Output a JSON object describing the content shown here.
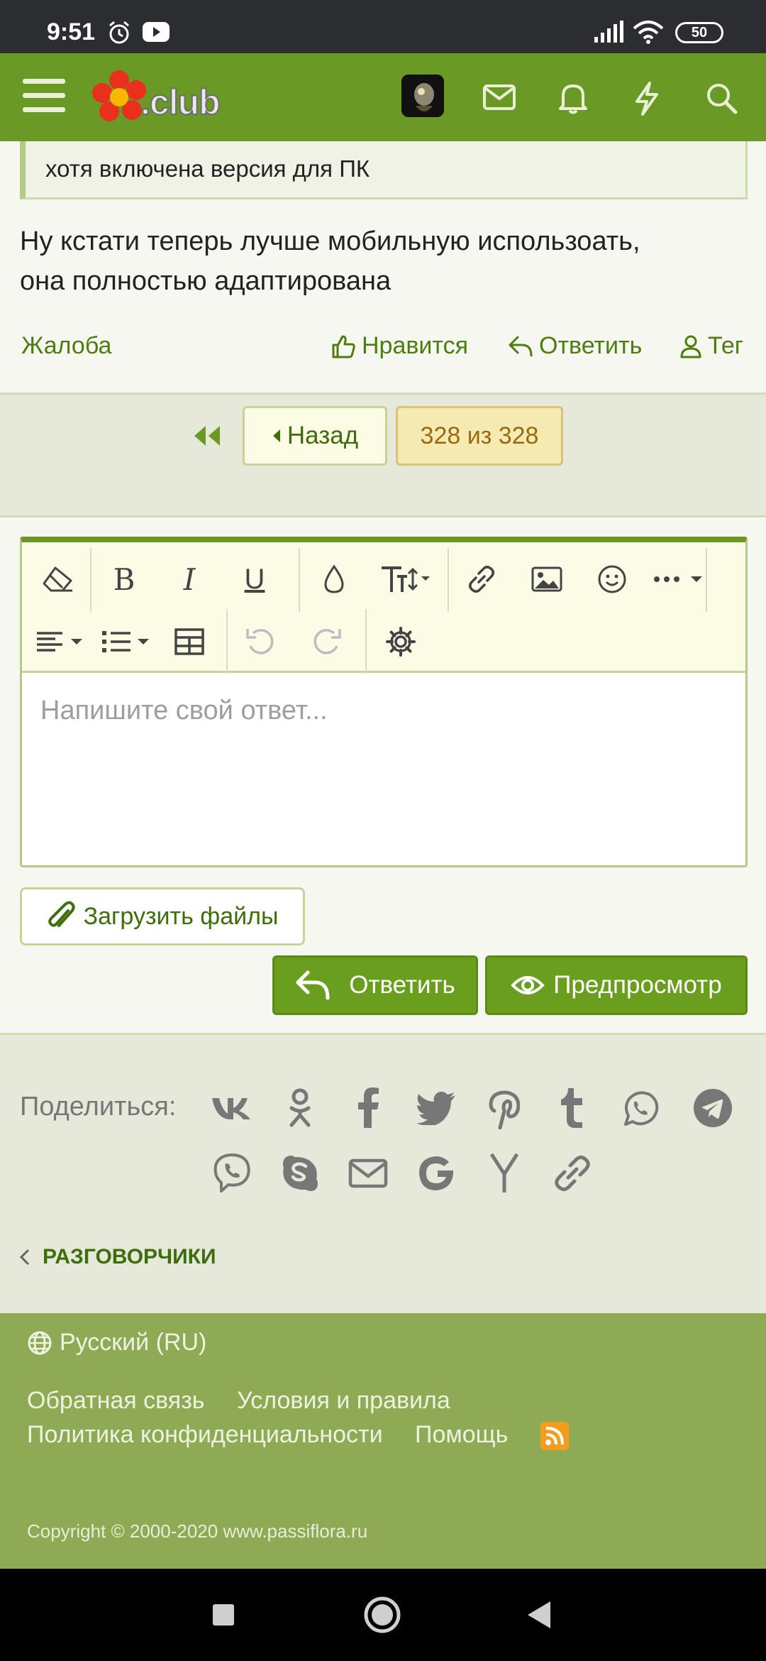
{
  "status_bar": {
    "time": "9:51",
    "battery": "50"
  },
  "header": {
    "logo_text": ".club",
    "icons": [
      "menu-icon",
      "avatar",
      "mail-icon",
      "bell-icon",
      "lightning-icon",
      "search-icon"
    ]
  },
  "post": {
    "quote_text": "хотя включена версия для ПК",
    "body_line1": "Ну кстати теперь лучше мобильную использоать,",
    "body_line2": "она полностью адаптирована",
    "report_label": "Жалоба",
    "like_label": "Нравится",
    "reply_label": "Ответить",
    "tag_label": "Тег"
  },
  "pager": {
    "back_label": "Назад",
    "count_label": "328 из 328"
  },
  "editor": {
    "placeholder": "Напишите свой ответ...",
    "toolbar": [
      "eraser-icon",
      "bold-icon",
      "italic-icon",
      "underline-icon",
      "color-drop-icon",
      "text-size-icon",
      "link-icon",
      "image-icon",
      "smile-icon",
      "more-icon",
      "align-icon",
      "list-icon",
      "table-icon",
      "undo-icon",
      "redo-icon",
      "settings-icon"
    ]
  },
  "buttons": {
    "upload_label": "Загрузить файлы",
    "reply_label": "Ответить",
    "preview_label": "Предпросмотр"
  },
  "share": {
    "label": "Поделиться:",
    "icons": [
      "vk-icon",
      "odnoklassniki-icon",
      "facebook-icon",
      "twitter-icon",
      "pinterest-icon",
      "tumblr-icon",
      "whatsapp-icon",
      "telegram-icon",
      "viber-icon",
      "skype-icon",
      "email-icon",
      "google-icon",
      "yandex-icon",
      "link-icon"
    ]
  },
  "breadcrumb": {
    "label": "РАЗГОВОРЧИКИ"
  },
  "footer": {
    "language": "Русский (RU)",
    "link_feedback": "Обратная связь",
    "link_terms": "Условия и правила",
    "link_privacy": "Политика конфиденциальности",
    "link_help": "Помощь",
    "copyright": "Copyright © 2000-2020 www.passiflora.ru"
  },
  "colors": {
    "brand_green": "#6a9a25",
    "footer_green": "#8eaa55",
    "pager_count_bg": "#f4eab2",
    "rss_orange": "#f39c1e"
  }
}
